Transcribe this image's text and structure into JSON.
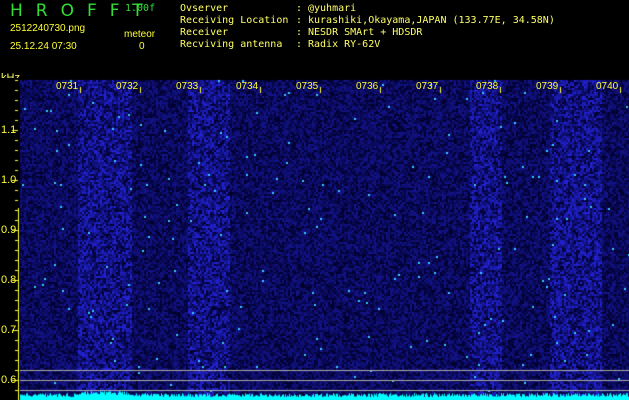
{
  "app": {
    "logo": "HROFFT",
    "version": "1.00f",
    "filename": "2512240730.png",
    "datetime": "25.12.24 07:30",
    "meteor_label": "meteor",
    "meteor_count": "0"
  },
  "info": [
    {
      "label": "Ovserver",
      "value": "@yuhmari"
    },
    {
      "label": "Receiving Location",
      "value": "kurashiki,Okayama,JAPAN (133.77E, 34.58N)"
    },
    {
      "label": "Receiver",
      "value": "NESDR SMArt + HDSDR"
    },
    {
      "label": "Recviving antenna",
      "value": "Radix RY-62V"
    }
  ],
  "axis": {
    "unit": "kHz",
    "times": [
      "0731",
      "0732",
      "0733",
      "0734",
      "0735",
      "0736",
      "0737",
      "0738",
      "0739",
      "0740"
    ],
    "freqs": [
      "1.1",
      "1.0",
      "0.9",
      "0.8",
      "0.7",
      "0.6"
    ]
  },
  "colors": {
    "signal": "#3333ff",
    "spectrum": "#00ffff",
    "text": "#ffff33"
  }
}
